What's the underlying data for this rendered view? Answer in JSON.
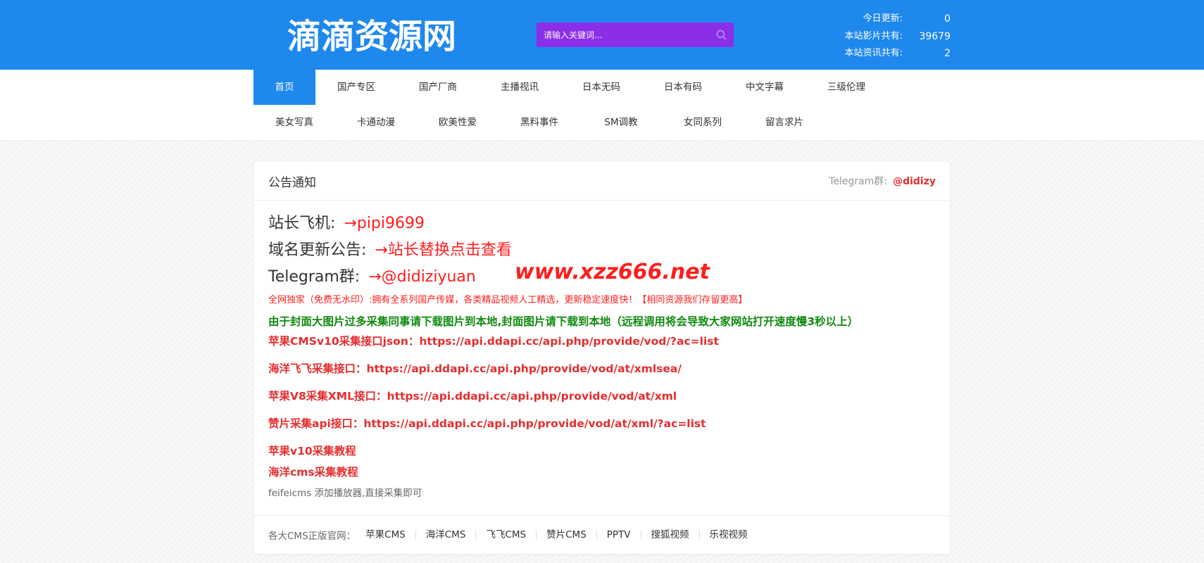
{
  "header": {
    "logo": "滴滴资源网",
    "search_placeholder": "请输入关键词...",
    "stats": [
      {
        "label": "今日更新:",
        "value": "0"
      },
      {
        "label": "本站影片共有:",
        "value": "39679"
      },
      {
        "label": "本站资讯共有:",
        "value": "2"
      }
    ]
  },
  "nav": {
    "row1": [
      "首页",
      "国产专区",
      "国产厂商",
      "主播视讯",
      "日本无码",
      "日本有码",
      "中文字幕",
      "三级伦理"
    ],
    "row2": [
      "美女写真",
      "卡通动漫",
      "欧美性爱",
      "黑料事件",
      "SM调教",
      "女同系列",
      "留言求片"
    ]
  },
  "notice": {
    "title": "公告通知",
    "tg_label": "Telegram群:",
    "tg_handle": "@didizy",
    "lines": [
      {
        "label": "站长飞机:",
        "value": "→pipi9699"
      },
      {
        "label": "域名更新公告:",
        "value": "→站长替换点击查看"
      },
      {
        "label": "Telegram群:",
        "value": "→@didiziyuan"
      }
    ],
    "watermark": "www.xzz666.net",
    "exclusive": "全网独家（免费无水印）:拥有全系列国产传媒，各类精品视频人工精选，更新稳定速度快！【相同资源我们存留更高】",
    "green_notice": "由于封面大图片过多采集同事请下载图片到本地,封面图片请下载到本地（远程调用将会导致大家网站打开速度慢3秒以上）",
    "api_lines": [
      "苹果CMSv10采集接口json：https://api.ddapi.cc/api.php/provide/vod/?ac=list",
      "海洋飞飞采集接口：https://api.ddapi.cc/api.php/provide/vod/at/xmlsea/",
      "苹果V8采集XML接口：https://api.ddapi.cc/api.php/provide/vod/at/xml",
      "赞片采集api接口：https://api.ddapi.cc/api.php/provide/vod/at/xml/?ac=list"
    ],
    "tutorials": [
      "苹果v10采集教程",
      "海洋cms采集教程"
    ],
    "feifei": "feifeicms 添加播放器,直接采集即可"
  },
  "footer": {
    "label": "各大CMS正版官网：",
    "links": [
      "苹果CMS",
      "海洋CMS",
      "飞飞CMS",
      "赞片CMS",
      "PPTV",
      "搜狐视频",
      "乐视视频"
    ]
  }
}
